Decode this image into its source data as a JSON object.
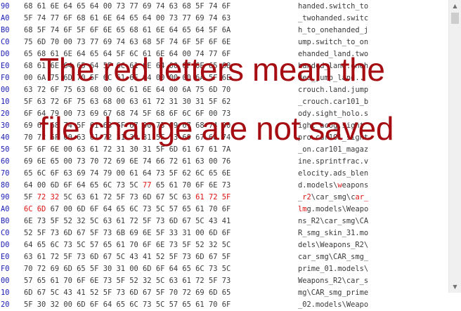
{
  "hex_rows": [
    {
      "off": "90",
      "bytes": [
        "68",
        "61",
        "6E",
        "64",
        "65",
        "64",
        "00",
        "73",
        "77",
        "69",
        "74",
        "63",
        "68",
        "5F",
        "74",
        "6F"
      ],
      "ascii": "handed.switch_to"
    },
    {
      "off": "A0",
      "bytes": [
        "5F",
        "74",
        "77",
        "6F",
        "68",
        "61",
        "6E",
        "64",
        "65",
        "64",
        "00",
        "73",
        "77",
        "69",
        "74",
        "63"
      ],
      "ascii": "_twohanded.switc"
    },
    {
      "off": "B0",
      "bytes": [
        "68",
        "5F",
        "74",
        "6F",
        "5F",
        "6F",
        "6E",
        "65",
        "68",
        "61",
        "6E",
        "64",
        "65",
        "64",
        "5F",
        "6A"
      ],
      "ascii": "h_to_onehanded_j"
    },
    {
      "off": "C0",
      "bytes": [
        "75",
        "6D",
        "70",
        "00",
        "73",
        "77",
        "69",
        "74",
        "63",
        "68",
        "5F",
        "74",
        "6F",
        "5F",
        "6F",
        "6E"
      ],
      "ascii": "ump.switch_to_on"
    },
    {
      "off": "D0",
      "bytes": [
        "65",
        "68",
        "61",
        "6E",
        "64",
        "65",
        "64",
        "5F",
        "6C",
        "61",
        "6E",
        "64",
        "00",
        "74",
        "77",
        "6F"
      ],
      "ascii": "ehanded_land.two"
    },
    {
      "off": "E0",
      "bytes": [
        "68",
        "61",
        "6E",
        "64",
        "65",
        "64",
        "5F",
        "6C",
        "61",
        "6E",
        "64",
        "00",
        "6F",
        "6E",
        "65",
        "68"
      ],
      "ascii": "handed_land.oneh"
    },
    {
      "off": "F0",
      "bytes": [
        "00",
        "6A",
        "75",
        "6D",
        "70",
        "5F",
        "6C",
        "61",
        "6E",
        "64",
        "00",
        "00",
        "00",
        "6A",
        "5F",
        "6E"
      ],
      "ascii": "ded_jump_land.."
    },
    {
      "off": "00",
      "bytes": [
        "63",
        "72",
        "6F",
        "75",
        "63",
        "68",
        "00",
        "6C",
        "61",
        "6E",
        "64",
        "00",
        "6A",
        "75",
        "6D",
        "70"
      ],
      "ascii": "crouch.land.jump"
    },
    {
      "off": "10",
      "bytes": [
        "5F",
        "63",
        "72",
        "6F",
        "75",
        "63",
        "68",
        "00",
        "63",
        "61",
        "72",
        "31",
        "30",
        "31",
        "5F",
        "62"
      ],
      "ascii": "_crouch.car101_b"
    },
    {
      "off": "20",
      "bytes": [
        "6F",
        "64",
        "79",
        "00",
        "73",
        "69",
        "67",
        "68",
        "74",
        "5F",
        "68",
        "6F",
        "6C",
        "6F",
        "00",
        "73"
      ],
      "ascii": "ody.sight_holo.s"
    },
    {
      "off": "30",
      "bytes": [
        "69",
        "67",
        "68",
        "74",
        "5F",
        "61",
        "63",
        "6F",
        "67",
        "00",
        "73",
        "69",
        "67",
        "68",
        "74",
        "00"
      ],
      "ascii": "ight_acog.sight"
    },
    {
      "off": "40",
      "bytes": [
        "70",
        "72",
        "6F",
        "00",
        "63",
        "61",
        "72",
        "31",
        "30",
        "31",
        "5F",
        "73",
        "69",
        "67",
        "68",
        "74"
      ],
      "ascii": "pro.car101_sight"
    },
    {
      "off": "50",
      "bytes": [
        "5F",
        "6F",
        "6E",
        "00",
        "63",
        "61",
        "72",
        "31",
        "30",
        "31",
        "5F",
        "6D",
        "61",
        "67",
        "61",
        "7A"
      ],
      "ascii": "_on.car101_magaz"
    },
    {
      "off": "60",
      "bytes": [
        "69",
        "6E",
        "65",
        "00",
        "73",
        "70",
        "72",
        "69",
        "6E",
        "74",
        "66",
        "72",
        "61",
        "63",
        "00",
        "76"
      ],
      "ascii": "ine.sprintfrac.v"
    },
    {
      "off": "70",
      "bytes": [
        "65",
        "6C",
        "6F",
        "63",
        "69",
        "74",
        "79",
        "00",
        "61",
        "64",
        "73",
        "5F",
        "62",
        "6C",
        "65",
        "6E"
      ],
      "ascii": "elocity.ads_blen"
    },
    {
      "off": "80",
      "bytes": [
        "64",
        "00",
        "6D",
        "6F",
        "64",
        "65",
        "6C",
        "73",
        "5C",
        "77",
        "65",
        "61",
        "70",
        "6F",
        "6E",
        "73"
      ],
      "ascii": "d.models\\weapons"
    },
    {
      "off": "90",
      "bytes": [
        "5F",
        "72",
        "32",
        "5C",
        "63",
        "61",
        "72",
        "5F",
        "73",
        "6D",
        "67",
        "5C",
        "63",
        "61",
        "72",
        "5F"
      ],
      "ascii": "_r2\\car_smg\\car_"
    },
    {
      "off": "A0",
      "bytes": [
        "6C",
        "6D",
        "67",
        "00",
        "6D",
        "6F",
        "64",
        "65",
        "6C",
        "73",
        "5C",
        "57",
        "65",
        "61",
        "70",
        "6F"
      ],
      "ascii": "lmg.models\\Weapo"
    },
    {
      "off": "B0",
      "bytes": [
        "6E",
        "73",
        "5F",
        "52",
        "32",
        "5C",
        "63",
        "61",
        "72",
        "5F",
        "73",
        "6D",
        "67",
        "5C",
        "43",
        "41"
      ],
      "ascii": "ns_R2\\car_smg\\CA"
    },
    {
      "off": "C0",
      "bytes": [
        "52",
        "5F",
        "73",
        "6D",
        "67",
        "5F",
        "73",
        "6B",
        "69",
        "6E",
        "5F",
        "33",
        "31",
        "00",
        "6D",
        "6F"
      ],
      "ascii": "R_smg_skin_31.mo"
    },
    {
      "off": "D0",
      "bytes": [
        "64",
        "65",
        "6C",
        "73",
        "5C",
        "57",
        "65",
        "61",
        "70",
        "6F",
        "6E",
        "73",
        "5F",
        "52",
        "32",
        "5C"
      ],
      "ascii": "dels\\Weapons_R2\\"
    },
    {
      "off": "E0",
      "bytes": [
        "63",
        "61",
        "72",
        "5F",
        "73",
        "6D",
        "67",
        "5C",
        "43",
        "41",
        "52",
        "5F",
        "73",
        "6D",
        "67",
        "5F"
      ],
      "ascii": "car_smg\\CAR_smg_"
    },
    {
      "off": "F0",
      "bytes": [
        "70",
        "72",
        "69",
        "6D",
        "65",
        "5F",
        "30",
        "31",
        "00",
        "6D",
        "6F",
        "64",
        "65",
        "6C",
        "73",
        "5C"
      ],
      "ascii": "prime_01.models\\"
    },
    {
      "off": "00",
      "bytes": [
        "57",
        "65",
        "61",
        "70",
        "6F",
        "6E",
        "73",
        "5F",
        "52",
        "32",
        "5C",
        "63",
        "61",
        "72",
        "5F",
        "73"
      ],
      "ascii": "Weapons_R2\\car_s"
    },
    {
      "off": "10",
      "bytes": [
        "6D",
        "67",
        "5C",
        "43",
        "41",
        "52",
        "5F",
        "73",
        "6D",
        "67",
        "5F",
        "70",
        "72",
        "69",
        "6D",
        "65"
      ],
      "ascii": "mg\\CAR_smg_prime"
    },
    {
      "off": "20",
      "bytes": [
        "5F",
        "30",
        "32",
        "00",
        "6D",
        "6F",
        "64",
        "65",
        "6C",
        "73",
        "5C",
        "57",
        "65",
        "61",
        "70",
        "6F"
      ],
      "ascii": "_02.models\\Weapo"
    }
  ],
  "changed": [
    {
      "row": 15,
      "bytes": [
        9
      ],
      "chars": [
        9
      ]
    },
    {
      "row": 16,
      "bytes": [
        1,
        2,
        13,
        14,
        15
      ],
      "chars": [
        1,
        2,
        13,
        14,
        15
      ]
    },
    {
      "row": 17,
      "bytes": [
        0,
        1
      ],
      "chars": [
        0,
        1
      ]
    }
  ],
  "overlay": {
    "line1": "The red letters mean the",
    "line2": "file change are not saved"
  },
  "colors": {
    "offset": "#1b1bb2",
    "text": "#3a3a3a",
    "changed": "#dd1111",
    "overlay": "#a50d12"
  },
  "scrollbar": {
    "up_icon": "triangle-up",
    "down_icon": "triangle-down",
    "up_glyph": "▲",
    "down_glyph": "▼"
  }
}
